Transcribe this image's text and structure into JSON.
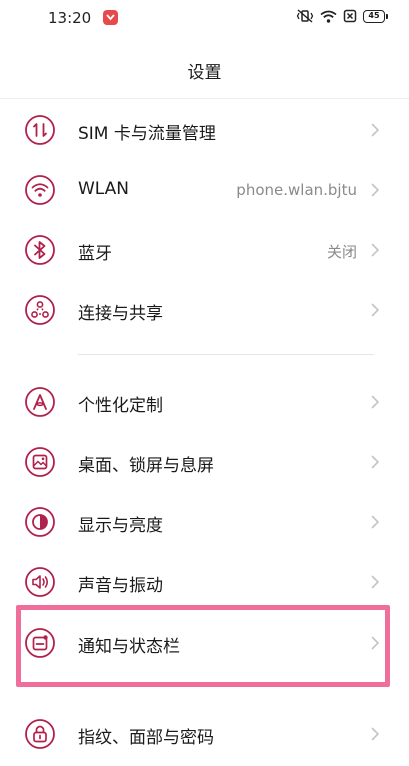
{
  "status_bar": {
    "time": "13:20",
    "battery": "45"
  },
  "header": {
    "title": "设置"
  },
  "colors": {
    "accent": "#b0214d",
    "highlight": "#f06e9c"
  },
  "items": [
    {
      "label": "SIM 卡与流量管理",
      "value": "",
      "icon": "sim-data-icon"
    },
    {
      "label": "WLAN",
      "value": "phone.wlan.bjtu",
      "icon": "wifi-icon"
    },
    {
      "label": "蓝牙",
      "value": "关闭",
      "icon": "bluetooth-icon"
    },
    {
      "label": "连接与共享",
      "value": "",
      "icon": "share-nodes-icon"
    },
    {
      "label": "个性化定制",
      "value": "",
      "icon": "personalize-icon"
    },
    {
      "label": "桌面、锁屏与息屏",
      "value": "",
      "icon": "wallpaper-icon"
    },
    {
      "label": "显示与亮度",
      "value": "",
      "icon": "brightness-icon"
    },
    {
      "label": "声音与振动",
      "value": "",
      "icon": "speaker-icon"
    },
    {
      "label": "通知与状态栏",
      "value": "",
      "icon": "notification-icon"
    },
    {
      "label": "指纹、面部与密码",
      "value": "",
      "icon": "lock-icon"
    }
  ]
}
